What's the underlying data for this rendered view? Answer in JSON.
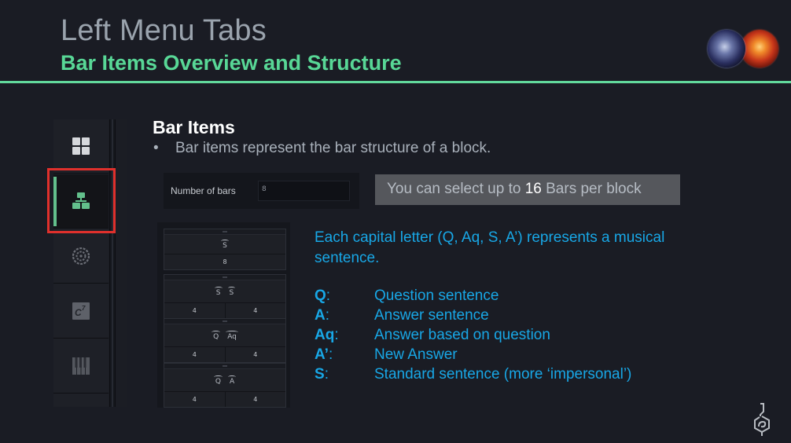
{
  "header": {
    "title": "Left Menu Tabs",
    "subtitle": "Bar Items Overview and Structure",
    "accent_color": "#58d796"
  },
  "sidebar": {
    "items": [
      {
        "name": "grid",
        "icon": "grid-icon",
        "active": false
      },
      {
        "name": "bar-items",
        "icon": "hierarchy-icon",
        "active": true
      },
      {
        "name": "circle-of-fifths",
        "icon": "circle-dial-icon",
        "active": false
      },
      {
        "name": "chords",
        "icon": "chord-c7-icon",
        "label": "C7",
        "active": false
      },
      {
        "name": "piano",
        "icon": "piano-keys-icon",
        "active": false
      }
    ],
    "highlight_color": "#e0302c"
  },
  "content": {
    "section_title": "Bar Items",
    "bullet_marker": "•",
    "bullet_text": "Bar items represent the bar structure of a block.",
    "bars_field": {
      "label": "Number of bars",
      "value": "8"
    },
    "info_box": {
      "prefix": "You can select up to ",
      "highlight": "16",
      "suffix": " Bars per block"
    },
    "bar_blocks": [
      {
        "sentences": [
          "S"
        ],
        "counts": [
          "8"
        ]
      },
      {
        "sentences": [
          "S",
          "S"
        ],
        "counts": [
          "4",
          "4"
        ]
      },
      {
        "sentences": [
          "Q",
          "Aq"
        ],
        "counts": [
          "4",
          "4"
        ]
      },
      {
        "sentences": [
          "Q",
          "A"
        ],
        "counts": [
          "4",
          "4"
        ]
      }
    ],
    "explanation": "Each capital letter (Q, Aq, S, A’) represents a musical sentence.",
    "legend": [
      {
        "key": "Q",
        "desc": "Question sentence"
      },
      {
        "key": "A",
        "desc": "Answer sentence"
      },
      {
        "key": "Aq",
        "desc": "Answer based on question"
      },
      {
        "key": "A’",
        "desc": "New Answer"
      },
      {
        "key": "S",
        "desc": "Standard sentence (more ‘impersonal’)"
      }
    ],
    "text_color": "#18a7e6"
  }
}
